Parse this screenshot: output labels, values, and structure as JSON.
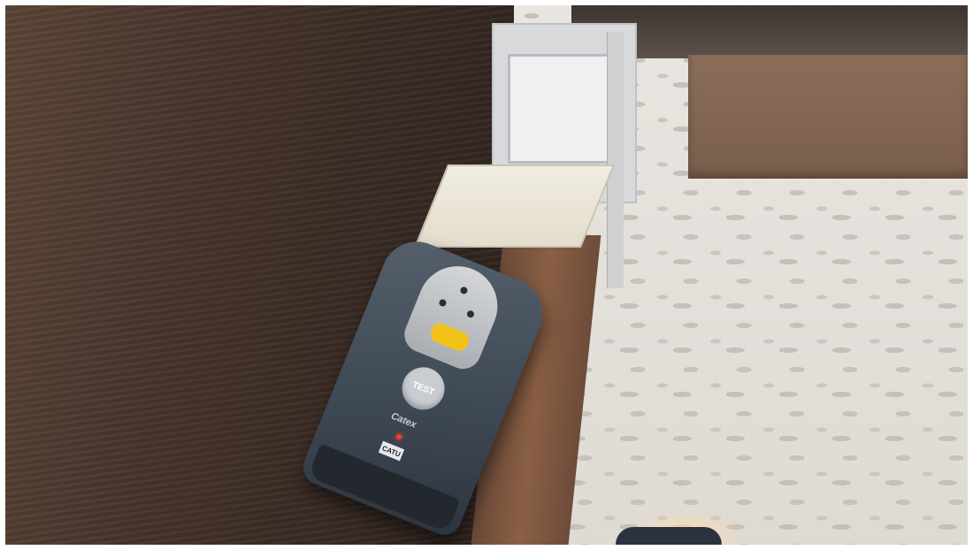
{
  "scene": {
    "description_tag": "hotel-room-key-card-switch"
  },
  "device": {
    "button_label": "TEST",
    "brand_label": "Catex",
    "logo_label": "CATU"
  },
  "colors": {
    "wood": "#4a372d",
    "wallpaper": "#e6e2dc",
    "device_body": "#3d4753",
    "accent_yellow": "#f2c21b",
    "led_red": "#ff3b30"
  }
}
